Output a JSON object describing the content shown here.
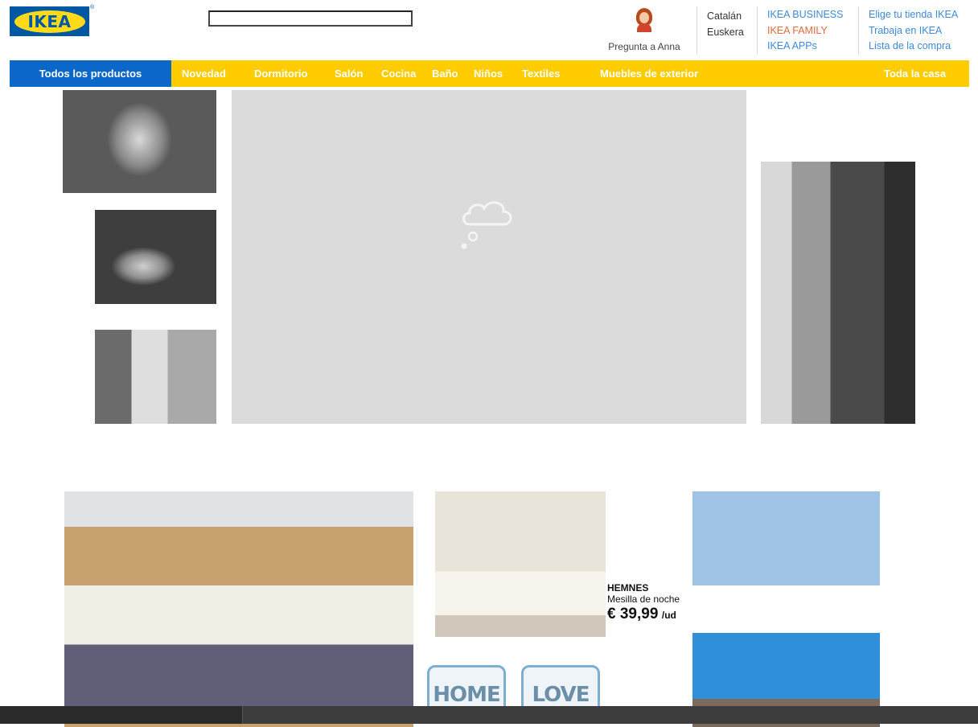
{
  "brand": {
    "logo_text": "IKEA",
    "reg_mark": "®"
  },
  "search": {
    "value": "",
    "placeholder": ""
  },
  "anna": {
    "label": "Pregunta a Anna"
  },
  "languages": [
    "Catalán",
    "Euskera"
  ],
  "business_links": [
    "IKEA BUSINESS",
    "IKEA FAMILY",
    "IKEA APPs"
  ],
  "store_links": [
    "Elige tu tienda IKEA",
    "Trabaja en IKEA",
    "Lista de la compra"
  ],
  "nav": {
    "all_products": "Todos los productos",
    "items": [
      "Novedad",
      "Dormitorio",
      "Salón",
      "Cocina",
      "Baño",
      "Niños",
      "Textiles",
      "Muebles de exterior",
      "Toda la casa"
    ]
  },
  "promo": {
    "name": "HEMNES",
    "description": "Mesilla de noche",
    "price": "€ 39,99",
    "unit": "/ud"
  },
  "decor": {
    "pin1": "HOME",
    "pin2": "LOVE"
  },
  "colors": {
    "ikea_blue": "#0058a3",
    "nav_yellow": "#ffcc00",
    "nav_all_blue": "#0b68c9",
    "link_blue": "#3f8ad6",
    "family_orange": "#e06b3c"
  }
}
